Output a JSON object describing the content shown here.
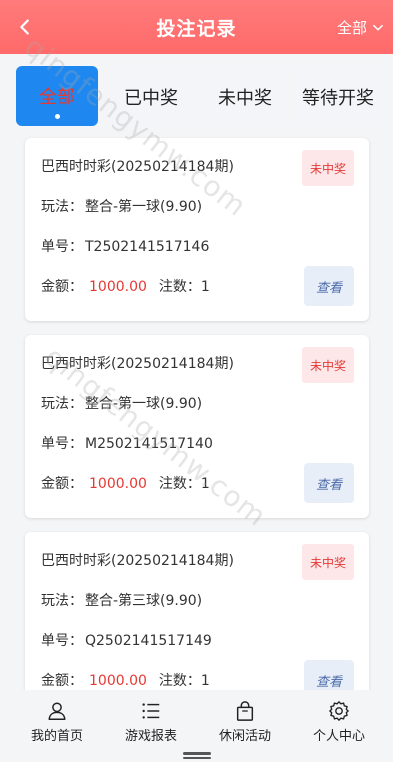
{
  "header": {
    "title": "投注记录",
    "filter_label": "全部"
  },
  "tabs": [
    {
      "label": "全部",
      "active": true
    },
    {
      "label": "已中奖",
      "active": false
    },
    {
      "label": "未中奖",
      "active": false
    },
    {
      "label": "等待开奖",
      "active": false
    }
  ],
  "labels": {
    "play": "玩法：",
    "order": "单号：",
    "amount": "金额：",
    "count": "注数：",
    "view": "查看"
  },
  "records": [
    {
      "name": "巴西时时彩(20250214184期)",
      "status": "未中奖",
      "play": "整合-第一球(9.90)",
      "order": "T2502141517146",
      "amount": "1000.00",
      "count": "1"
    },
    {
      "name": "巴西时时彩(20250214184期)",
      "status": "未中奖",
      "play": "整合-第一球(9.90)",
      "order": "M2502141517140",
      "amount": "1000.00",
      "count": "1"
    },
    {
      "name": "巴西时时彩(20250214184期)",
      "status": "未中奖",
      "play": "整合-第三球(9.90)",
      "order": "Q2502141517149",
      "amount": "1000.00",
      "count": "1"
    }
  ],
  "bottom_nav": [
    {
      "label": "我的首页",
      "icon": "user-icon"
    },
    {
      "label": "游戏报表",
      "icon": "list-icon"
    },
    {
      "label": "休闲活动",
      "icon": "bag-icon"
    },
    {
      "label": "个人中心",
      "icon": "gear-icon"
    }
  ],
  "watermark": "qingfengymw.com",
  "colors": {
    "header": "#ff6a6a",
    "active_tab": "#1e88f0",
    "amount": "#e53935"
  }
}
